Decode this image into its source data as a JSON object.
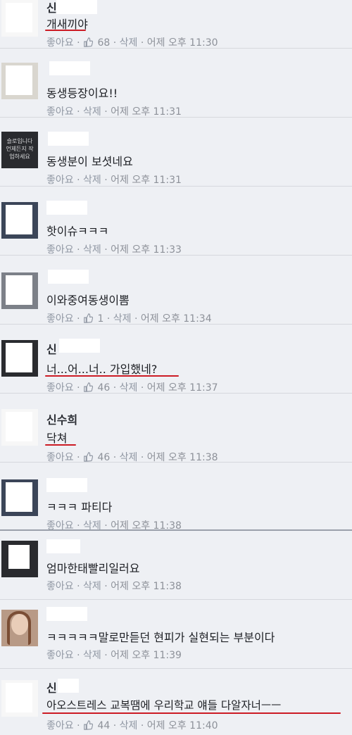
{
  "actions": {
    "like": "좋아요",
    "delete": "삭제",
    "sep": " · "
  },
  "comments": [
    {
      "name": "신",
      "text": "개새끼야",
      "likes": "68",
      "time": "어제 오후 11:30"
    },
    {
      "name": "",
      "text": "동생등장이요!!",
      "likes": "",
      "time": "어제 오후 11:31"
    },
    {
      "name": "",
      "text": "동생분이 보셧네요",
      "likes": "",
      "time": "어제 오후 11:31",
      "avatar_text": "슬로입니다 언제든지 작업하세요"
    },
    {
      "name": "",
      "text": "핫이슈ㅋㅋㅋ",
      "likes": "",
      "time": "어제 오후 11:33"
    },
    {
      "name": "",
      "text": "이와중여동생이뽐",
      "likes": "1",
      "time": "어제 오후 11:34"
    },
    {
      "name": "신",
      "text": "너...어...너.. 가입했네?",
      "likes": "46",
      "time": "어제 오후 11:37"
    },
    {
      "name": "신수희",
      "text": "닥쳐",
      "likes": "46",
      "time": "어제 오후 11:38"
    },
    {
      "name": "",
      "text": "ㅋㅋㅋ 파티다",
      "likes": "",
      "time": "어제 오후 11:38"
    },
    {
      "name": "",
      "text": "엄마한태빨리일러요",
      "likes": "",
      "time": "어제 오후 11:38"
    },
    {
      "name": "",
      "text": "ㅋㅋㅋㅋㅋ말로만듣던 현피가 실현되는 부분이다",
      "likes": "",
      "time": "어제 오후 11:39"
    },
    {
      "name": "신",
      "text": "아오스트레스 교복땜에 우리학교 얘들 다알자너ㅡㅡ",
      "likes": "44",
      "time": "어제 오후 11:40"
    }
  ],
  "colors": {
    "underline": "#cc1b24",
    "meta": "#8d9199",
    "text": "#1d1f24"
  }
}
